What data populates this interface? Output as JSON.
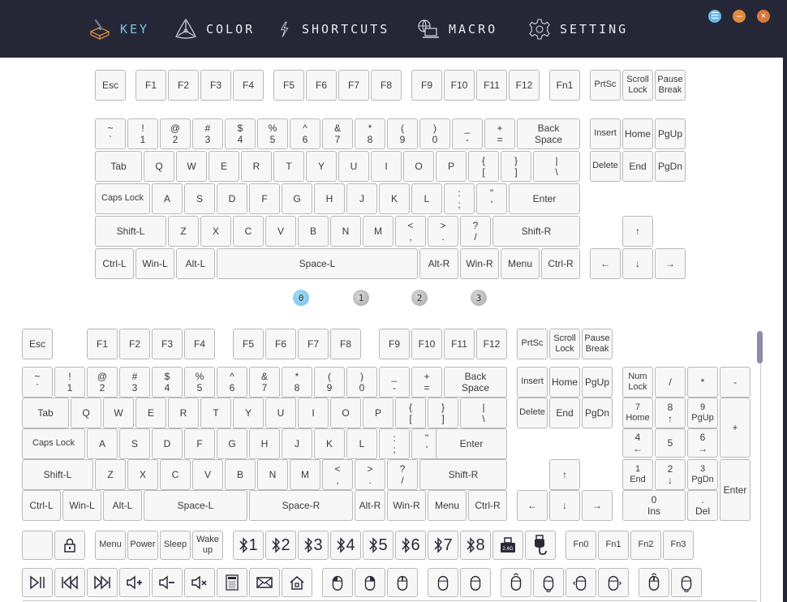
{
  "nav": {
    "items": [
      {
        "id": "key",
        "label": "KEY",
        "icon": "keycap-icon",
        "active": true
      },
      {
        "id": "color",
        "label": "COLOR",
        "icon": "color-triangle-icon",
        "active": false
      },
      {
        "id": "shortcuts",
        "label": "SHORTCUTS",
        "icon": "lightning-icon",
        "active": false
      },
      {
        "id": "macro",
        "label": "MACRO",
        "icon": "globe-laptop-icon",
        "active": false
      },
      {
        "id": "setting",
        "label": "SETTING",
        "icon": "gear-icon",
        "active": false
      }
    ]
  },
  "window_controls": {
    "menu": {
      "glyph": "☰",
      "color": "#6ab8ea"
    },
    "minimize": {
      "glyph": "–",
      "color": "#e08a40"
    },
    "close": {
      "glyph": "×",
      "color": "#d8783a"
    }
  },
  "layers": {
    "active": 0,
    "items": [
      "0",
      "1",
      "2",
      "3"
    ]
  },
  "device_keyboard": {
    "keys": [
      {
        "id": "esc",
        "t": "Esc"
      },
      {
        "id": "f1",
        "t": "F1"
      },
      {
        "id": "f2",
        "t": "F2"
      },
      {
        "id": "f3",
        "t": "F3"
      },
      {
        "id": "f4",
        "t": "F4"
      },
      {
        "id": "f5",
        "t": "F5"
      },
      {
        "id": "f6",
        "t": "F6"
      },
      {
        "id": "f7",
        "t": "F7"
      },
      {
        "id": "f8",
        "t": "F8"
      },
      {
        "id": "f9",
        "t": "F9"
      },
      {
        "id": "f10",
        "t": "F10"
      },
      {
        "id": "f11",
        "t": "F11"
      },
      {
        "id": "f12",
        "t": "F12"
      },
      {
        "id": "fn1",
        "t": "Fn1"
      },
      {
        "id": "prtsc",
        "t": "PrtSc"
      },
      {
        "id": "scroll-lock",
        "t": "Scroll",
        "b": "Lock"
      },
      {
        "id": "pause-break",
        "t": "Pause",
        "b": "Break"
      },
      {
        "id": "grave",
        "t": "~",
        "b": "`"
      },
      {
        "id": "1",
        "t": "!",
        "b": "1"
      },
      {
        "id": "2",
        "t": "@",
        "b": "2"
      },
      {
        "id": "3",
        "t": "#",
        "b": "3"
      },
      {
        "id": "4",
        "t": "$",
        "b": "4"
      },
      {
        "id": "5",
        "t": "%",
        "b": "5"
      },
      {
        "id": "6",
        "t": "^",
        "b": "6"
      },
      {
        "id": "7",
        "t": "&",
        "b": "7"
      },
      {
        "id": "8",
        "t": "*",
        "b": "8"
      },
      {
        "id": "9",
        "t": "(",
        "b": "9"
      },
      {
        "id": "0",
        "t": ")",
        "b": "0"
      },
      {
        "id": "minus",
        "t": "_",
        "b": "-"
      },
      {
        "id": "equal",
        "t": "+",
        "b": "="
      },
      {
        "id": "backspace",
        "t": "Back",
        "b": "Space"
      },
      {
        "id": "insert",
        "t": "Insert"
      },
      {
        "id": "home",
        "t": "Home"
      },
      {
        "id": "pgup",
        "t": "PgUp"
      },
      {
        "id": "tab",
        "t": "Tab"
      },
      {
        "id": "q",
        "t": "Q"
      },
      {
        "id": "w",
        "t": "W"
      },
      {
        "id": "e",
        "t": "E"
      },
      {
        "id": "r",
        "t": "R"
      },
      {
        "id": "t",
        "t": "T"
      },
      {
        "id": "y",
        "t": "Y"
      },
      {
        "id": "u",
        "t": "U"
      },
      {
        "id": "i",
        "t": "I"
      },
      {
        "id": "o",
        "t": "O"
      },
      {
        "id": "p",
        "t": "P"
      },
      {
        "id": "lbracket",
        "t": "{",
        "b": "["
      },
      {
        "id": "rbracket",
        "t": "}",
        "b": "]"
      },
      {
        "id": "backslash",
        "t": "|",
        "b": "\\"
      },
      {
        "id": "delete",
        "t": "Delete"
      },
      {
        "id": "end",
        "t": "End"
      },
      {
        "id": "pgdn",
        "t": "PgDn"
      },
      {
        "id": "capslock",
        "t": "Caps Lock"
      },
      {
        "id": "a",
        "t": "A"
      },
      {
        "id": "s",
        "t": "S"
      },
      {
        "id": "d",
        "t": "D"
      },
      {
        "id": "f",
        "t": "F"
      },
      {
        "id": "g",
        "t": "G"
      },
      {
        "id": "h",
        "t": "H"
      },
      {
        "id": "j",
        "t": "J"
      },
      {
        "id": "k",
        "t": "K"
      },
      {
        "id": "l",
        "t": "L"
      },
      {
        "id": "semicolon",
        "t": ":",
        "b": ";"
      },
      {
        "id": "quote",
        "t": "\"",
        "b": "'"
      },
      {
        "id": "enter",
        "t": "Enter"
      },
      {
        "id": "shift-l",
        "t": "Shift-L"
      },
      {
        "id": "z",
        "t": "Z"
      },
      {
        "id": "x",
        "t": "X"
      },
      {
        "id": "c",
        "t": "C"
      },
      {
        "id": "v",
        "t": "V"
      },
      {
        "id": "b",
        "t": "B"
      },
      {
        "id": "n",
        "t": "N"
      },
      {
        "id": "m",
        "t": "M"
      },
      {
        "id": "comma",
        "t": "<",
        "b": ","
      },
      {
        "id": "period",
        "t": ">",
        "b": "."
      },
      {
        "id": "slash",
        "t": "?",
        "b": "/"
      },
      {
        "id": "shift-r",
        "t": "Shift-R"
      },
      {
        "id": "up",
        "t": "↑"
      },
      {
        "id": "ctrl-l",
        "t": "Ctrl-L"
      },
      {
        "id": "win-l",
        "t": "Win-L"
      },
      {
        "id": "alt-l",
        "t": "Alt-L"
      },
      {
        "id": "space-l",
        "t": "Space-L"
      },
      {
        "id": "alt-r",
        "t": "Alt-R"
      },
      {
        "id": "win-r",
        "t": "Win-R"
      },
      {
        "id": "menu",
        "t": "Menu"
      },
      {
        "id": "ctrl-r",
        "t": "Ctrl-R"
      },
      {
        "id": "left",
        "t": "←"
      },
      {
        "id": "down",
        "t": "↓"
      },
      {
        "id": "right",
        "t": "→"
      }
    ]
  },
  "palette_keyboard": {
    "keys": [
      {
        "id": "esc",
        "t": "Esc"
      },
      {
        "id": "f1",
        "t": "F1"
      },
      {
        "id": "f2",
        "t": "F2"
      },
      {
        "id": "f3",
        "t": "F3"
      },
      {
        "id": "f4",
        "t": "F4"
      },
      {
        "id": "f5",
        "t": "F5"
      },
      {
        "id": "f6",
        "t": "F6"
      },
      {
        "id": "f7",
        "t": "F7"
      },
      {
        "id": "f8",
        "t": "F8"
      },
      {
        "id": "f9",
        "t": "F9"
      },
      {
        "id": "f10",
        "t": "F10"
      },
      {
        "id": "f11",
        "t": "F11"
      },
      {
        "id": "f12",
        "t": "F12"
      },
      {
        "id": "prtsc",
        "t": "PrtSc"
      },
      {
        "id": "scroll-lock",
        "t": "Scroll",
        "b": "Lock"
      },
      {
        "id": "pause-break",
        "t": "Pause",
        "b": "Break"
      },
      {
        "id": "grave",
        "t": "~",
        "b": "`"
      },
      {
        "id": "1",
        "t": "!",
        "b": "1"
      },
      {
        "id": "2",
        "t": "@",
        "b": "2"
      },
      {
        "id": "3",
        "t": "#",
        "b": "3"
      },
      {
        "id": "4",
        "t": "$",
        "b": "4"
      },
      {
        "id": "5",
        "t": "%",
        "b": "5"
      },
      {
        "id": "6",
        "t": "^",
        "b": "6"
      },
      {
        "id": "7",
        "t": "&",
        "b": "7"
      },
      {
        "id": "8",
        "t": "*",
        "b": "8"
      },
      {
        "id": "9",
        "t": "(",
        "b": "9"
      },
      {
        "id": "0",
        "t": ")",
        "b": "0"
      },
      {
        "id": "minus",
        "t": "_",
        "b": "-"
      },
      {
        "id": "equal",
        "t": "+",
        "b": "="
      },
      {
        "id": "backspace",
        "t": "Back",
        "b": "Space"
      },
      {
        "id": "insert",
        "t": "Insert"
      },
      {
        "id": "home",
        "t": "Home"
      },
      {
        "id": "pgup",
        "t": "PgUp"
      },
      {
        "id": "numlock",
        "t": "Num",
        "b": "Lock"
      },
      {
        "id": "num-slash",
        "t": "/"
      },
      {
        "id": "num-star",
        "t": "*"
      },
      {
        "id": "num-minus",
        "t": "-"
      },
      {
        "id": "tab",
        "t": "Tab"
      },
      {
        "id": "q",
        "t": "Q"
      },
      {
        "id": "w",
        "t": "W"
      },
      {
        "id": "e",
        "t": "E"
      },
      {
        "id": "r",
        "t": "R"
      },
      {
        "id": "t",
        "t": "T"
      },
      {
        "id": "y",
        "t": "Y"
      },
      {
        "id": "u",
        "t": "U"
      },
      {
        "id": "i",
        "t": "I"
      },
      {
        "id": "o",
        "t": "O"
      },
      {
        "id": "p",
        "t": "P"
      },
      {
        "id": "lbracket",
        "t": "{",
        "b": "["
      },
      {
        "id": "rbracket",
        "t": "}",
        "b": "]"
      },
      {
        "id": "backslash",
        "t": "|",
        "b": "\\"
      },
      {
        "id": "delete",
        "t": "Delete"
      },
      {
        "id": "end",
        "t": "End"
      },
      {
        "id": "pgdn",
        "t": "PgDn"
      },
      {
        "id": "num7",
        "t": "7",
        "b": "Home"
      },
      {
        "id": "num8",
        "t": "8",
        "b": "↑"
      },
      {
        "id": "num9",
        "t": "9",
        "b": "PgUp"
      },
      {
        "id": "num-plus",
        "t": "+"
      },
      {
        "id": "capslock",
        "t": "Caps Lock"
      },
      {
        "id": "a",
        "t": "A"
      },
      {
        "id": "s",
        "t": "S"
      },
      {
        "id": "d",
        "t": "D"
      },
      {
        "id": "f",
        "t": "F"
      },
      {
        "id": "g",
        "t": "G"
      },
      {
        "id": "h",
        "t": "H"
      },
      {
        "id": "j",
        "t": "J"
      },
      {
        "id": "k",
        "t": "K"
      },
      {
        "id": "l",
        "t": "L"
      },
      {
        "id": "semicolon",
        "t": ":",
        "b": ";"
      },
      {
        "id": "quote",
        "t": "\"",
        "b": "'"
      },
      {
        "id": "enter",
        "t": "Enter"
      },
      {
        "id": "num4",
        "t": "4",
        "b": "←"
      },
      {
        "id": "num5",
        "t": "5"
      },
      {
        "id": "num6",
        "t": "6",
        "b": "→"
      },
      {
        "id": "shift-l",
        "t": "Shift-L"
      },
      {
        "id": "z",
        "t": "Z"
      },
      {
        "id": "x",
        "t": "X"
      },
      {
        "id": "c",
        "t": "C"
      },
      {
        "id": "v",
        "t": "V"
      },
      {
        "id": "b",
        "t": "B"
      },
      {
        "id": "n",
        "t": "N"
      },
      {
        "id": "m",
        "t": "M"
      },
      {
        "id": "comma",
        "t": "<",
        "b": ","
      },
      {
        "id": "period",
        "t": ">",
        "b": "."
      },
      {
        "id": "slash",
        "t": "?",
        "b": "/"
      },
      {
        "id": "shift-r",
        "t": "Shift-R"
      },
      {
        "id": "up",
        "t": "↑"
      },
      {
        "id": "num1",
        "t": "1",
        "b": "End"
      },
      {
        "id": "num2",
        "t": "2",
        "b": "↓"
      },
      {
        "id": "num3",
        "t": "3",
        "b": "PgDn"
      },
      {
        "id": "num-enter",
        "t": "Enter"
      },
      {
        "id": "ctrl-l",
        "t": "Ctrl-L"
      },
      {
        "id": "win-l",
        "t": "Win-L"
      },
      {
        "id": "alt-l",
        "t": "Alt-L"
      },
      {
        "id": "space-l",
        "t": "Space-L"
      },
      {
        "id": "space-r",
        "t": "Space-R"
      },
      {
        "id": "alt-r",
        "t": "Alt-R"
      },
      {
        "id": "win-r",
        "t": "Win-R"
      },
      {
        "id": "menu",
        "t": "Menu"
      },
      {
        "id": "ctrl-r",
        "t": "Ctrl-R"
      },
      {
        "id": "left",
        "t": "←"
      },
      {
        "id": "down",
        "t": "↓"
      },
      {
        "id": "right",
        "t": "→"
      },
      {
        "id": "num0",
        "t": "0",
        "b": "Ins"
      },
      {
        "id": "num-dot",
        "t": ".",
        "b": "Del"
      }
    ]
  },
  "special_keys": {
    "row1": [
      {
        "id": "blank",
        "t": "",
        "icon": ""
      },
      {
        "id": "lock",
        "t": "",
        "icon": "lock-icon"
      },
      {
        "id": "sys-menu",
        "t": "Menu"
      },
      {
        "id": "power",
        "t": "Power"
      },
      {
        "id": "sleep",
        "t": "Sleep"
      },
      {
        "id": "wakeup",
        "t": "Wake",
        "b": "up"
      },
      {
        "id": "bt1",
        "t": "1",
        "icon": "bluetooth-icon"
      },
      {
        "id": "bt2",
        "t": "2",
        "icon": "bluetooth-icon"
      },
      {
        "id": "bt3",
        "t": "3",
        "icon": "bluetooth-icon"
      },
      {
        "id": "bt4",
        "t": "4",
        "icon": "bluetooth-icon"
      },
      {
        "id": "bt5",
        "t": "5",
        "icon": "bluetooth-icon"
      },
      {
        "id": "bt6",
        "t": "6",
        "icon": "bluetooth-icon"
      },
      {
        "id": "bt7",
        "t": "7",
        "icon": "bluetooth-icon"
      },
      {
        "id": "bt8",
        "t": "8",
        "icon": "bluetooth-icon"
      },
      {
        "id": "dongle-2-4g",
        "t": "2.4G",
        "icon": "usb-dongle-icon"
      },
      {
        "id": "usb-wired",
        "t": "",
        "icon": "usb-cable-icon"
      },
      {
        "id": "fn0",
        "t": "Fn0"
      },
      {
        "id": "fn1",
        "t": "Fn1"
      },
      {
        "id": "fn2",
        "t": "Fn2"
      },
      {
        "id": "fn3",
        "t": "Fn3"
      }
    ],
    "row2": [
      {
        "id": "play-pause",
        "icon": "play-pause-icon",
        "glyph": "⏯"
      },
      {
        "id": "prev-track",
        "icon": "previous-track-icon",
        "glyph": "⏮"
      },
      {
        "id": "next-track",
        "icon": "next-track-icon",
        "glyph": "⏭"
      },
      {
        "id": "volume-up",
        "icon": "volume-up-icon",
        "glyph": "🔊+"
      },
      {
        "id": "volume-down",
        "icon": "volume-down-icon",
        "glyph": "🔉-"
      },
      {
        "id": "mute",
        "icon": "mute-icon",
        "glyph": "🔇"
      },
      {
        "id": "calculator",
        "icon": "calculator-icon",
        "glyph": "▦"
      },
      {
        "id": "mail",
        "icon": "mail-icon",
        "glyph": "✉"
      },
      {
        "id": "homepage",
        "icon": "home-icon",
        "glyph": "⌂"
      },
      {
        "id": "mouse-left",
        "icon": "mouse-left-click-icon"
      },
      {
        "id": "mouse-right",
        "icon": "mouse-right-click-icon"
      },
      {
        "id": "mouse-middle",
        "icon": "mouse-middle-click-icon"
      },
      {
        "id": "mouse-back",
        "icon": "mouse-back-icon"
      },
      {
        "id": "mouse-forward",
        "icon": "mouse-forward-icon"
      },
      {
        "id": "scroll-up",
        "icon": "mouse-scroll-up-icon"
      },
      {
        "id": "scroll-down",
        "icon": "mouse-scroll-down-icon"
      },
      {
        "id": "scroll-left",
        "icon": "mouse-scroll-left-icon"
      },
      {
        "id": "scroll-right",
        "icon": "mouse-scroll-right-icon"
      },
      {
        "id": "mouse-up",
        "icon": "mouse-move-up-icon"
      },
      {
        "id": "mouse-down",
        "icon": "mouse-move-down-icon"
      }
    ]
  },
  "colors": {
    "titlebar_bg": "#252736",
    "active_nav": "#7cc0ea",
    "nav_text": "#e8eaf0",
    "key_border": "#b9b9b9",
    "key_bg": "#f7f7f7",
    "accent_orange": "#e08a40"
  }
}
